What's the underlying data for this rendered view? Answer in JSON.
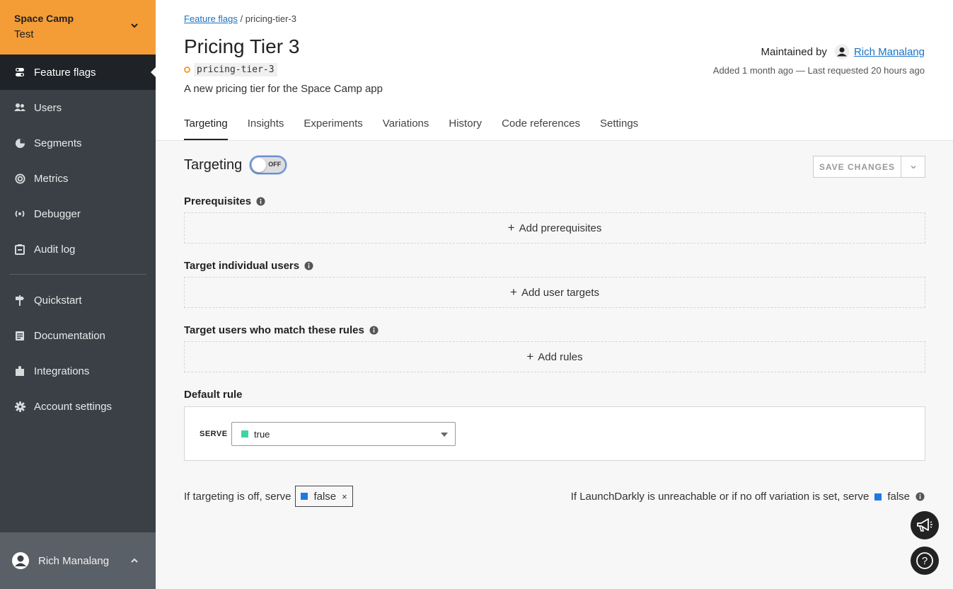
{
  "project": {
    "name": "Space Camp",
    "environment": "Test"
  },
  "nav": {
    "items": [
      {
        "label": "Feature flags",
        "icon": "toggle-icon",
        "active": true
      },
      {
        "label": "Users",
        "icon": "users-icon"
      },
      {
        "label": "Segments",
        "icon": "pie-icon"
      },
      {
        "label": "Metrics",
        "icon": "target-icon"
      },
      {
        "label": "Debugger",
        "icon": "broadcast-icon"
      },
      {
        "label": "Audit log",
        "icon": "clipboard-icon"
      }
    ],
    "secondary": [
      {
        "label": "Quickstart",
        "icon": "signpost-icon"
      },
      {
        "label": "Documentation",
        "icon": "document-icon"
      },
      {
        "label": "Integrations",
        "icon": "puzzle-icon"
      },
      {
        "label": "Account settings",
        "icon": "gear-icon"
      }
    ]
  },
  "user": {
    "name": "Rich Manalang"
  },
  "breadcrumb": {
    "parent": "Feature flags",
    "separator": "/",
    "current": "pricing-tier-3"
  },
  "flag": {
    "title": "Pricing Tier 3",
    "key": "pricing-tier-3",
    "description": "A new pricing tier for the Space Camp app",
    "maintained_label": "Maintained by",
    "maintainer": "Rich Manalang",
    "added": "Added 1 month ago — Last requested 20 hours ago"
  },
  "tabs": [
    "Targeting",
    "Insights",
    "Experiments",
    "Variations",
    "History",
    "Code references",
    "Settings"
  ],
  "targeting": {
    "label": "Targeting",
    "toggle_text": "OFF",
    "save_label": "SAVE CHANGES",
    "prerequisites_label": "Prerequisites",
    "add_prerequisites": "Add prerequisites",
    "individual_label": "Target individual users",
    "add_user_targets": "Add user targets",
    "rules_label": "Target users who match these rules",
    "add_rules": "Add rules",
    "default_rule_label": "Default rule",
    "serve_label": "SERVE",
    "serve_value": "true",
    "off_label": "If targeting is off, serve",
    "off_value": "false",
    "fallback_label": "If LaunchDarkly is unreachable or if no off variation is set, serve",
    "fallback_value": "false"
  },
  "colors": {
    "project": "#f49d37",
    "true_swatch": "#3dd6a0",
    "false_swatch": "#1f7ae0"
  }
}
